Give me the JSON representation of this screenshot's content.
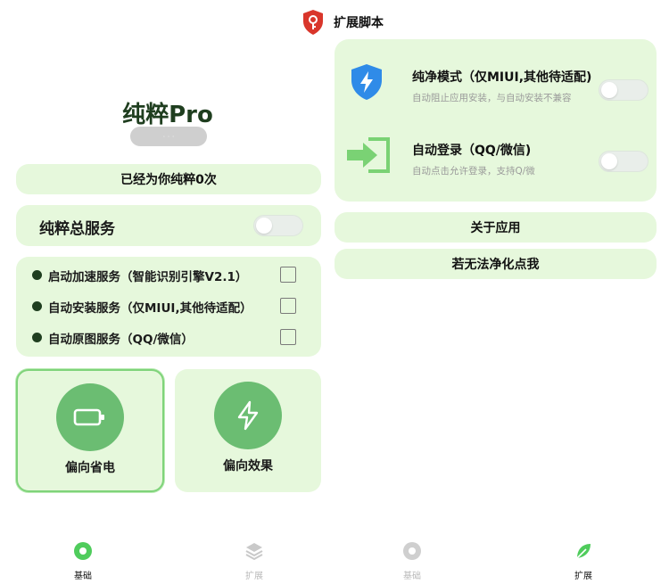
{
  "colors": {
    "card_bg": "#e6f8dc",
    "accent_green": "#6bbd72",
    "selected_border": "#7fd37a",
    "shield_blue": "#2f8be8",
    "header_red": "#d9362b"
  },
  "left": {
    "app_name": "纯粹Pro",
    "version_badge": "· · ·",
    "counter_text": "已经为你纯粹0次",
    "master_service": {
      "label": "纯粹总服务",
      "enabled": false
    },
    "services": [
      {
        "label": "启动加速服务（智能识别引擎V2.1）",
        "checked": false
      },
      {
        "label": "自动安装服务（仅MIUI,其他待适配）",
        "checked": false
      },
      {
        "label": "自动原图服务（QQ/微信）",
        "checked": false
      }
    ],
    "modes": [
      {
        "label": "偏向省电",
        "icon": "battery-icon",
        "selected": true
      },
      {
        "label": "偏向效果",
        "icon": "lightning-icon",
        "selected": false
      }
    ],
    "bottom_nav": [
      {
        "label": "基础",
        "icon": "gear-icon",
        "active": true
      },
      {
        "label": "扩展",
        "icon": "layers-icon",
        "active": false
      }
    ]
  },
  "right": {
    "header": {
      "title": "扩展脚本",
      "icon": "shield-key-icon"
    },
    "features": [
      {
        "title": "纯净模式（仅MIUI,其他待适配)",
        "desc": "自动阻止应用安装，与自动安装不兼容",
        "icon": "shield-lightning-icon",
        "enabled": false
      },
      {
        "title": "自动登录（QQ/微信)",
        "desc": "自动点击允许登录，支持Q/微",
        "icon": "login-arrow-icon",
        "enabled": false
      }
    ],
    "links": [
      {
        "label": "关于应用"
      },
      {
        "label": "若无法净化点我"
      }
    ],
    "bottom_nav": [
      {
        "label": "基础",
        "icon": "gear-icon",
        "active": false
      },
      {
        "label": "扩展",
        "icon": "leaf-icon",
        "active": true
      }
    ]
  }
}
